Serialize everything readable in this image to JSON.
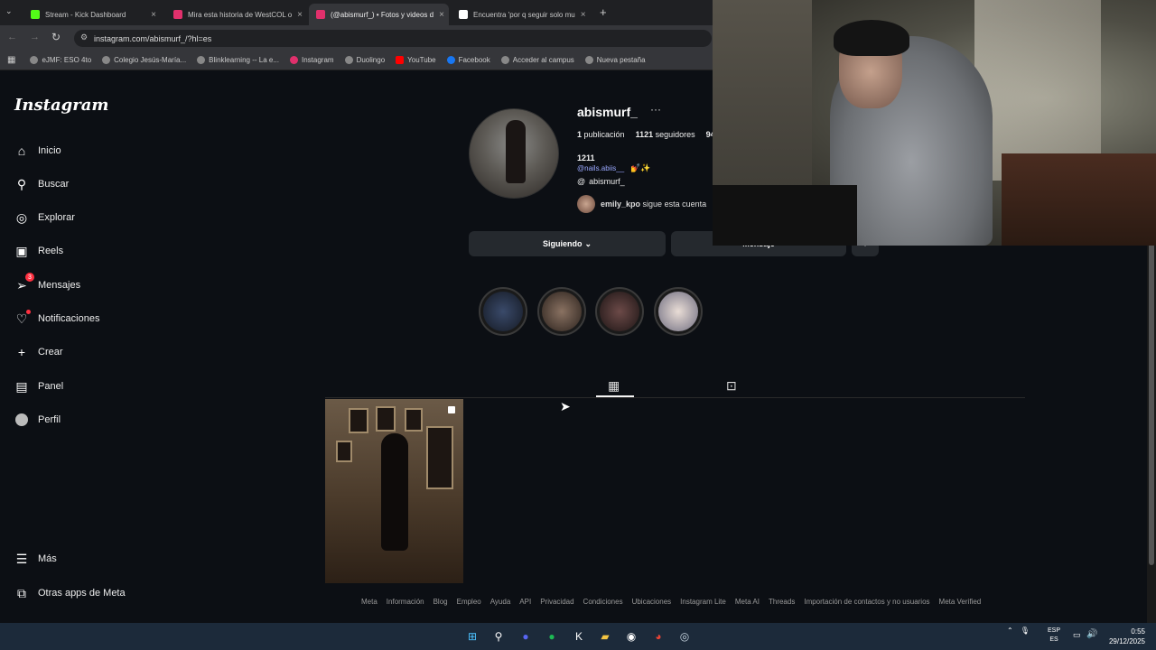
{
  "tabs": [
    {
      "label": "Stream - Kick Dashboard",
      "color": "#53fc18"
    },
    {
      "label": "Mira esta historia de WestCOL o",
      "color": "#e1306c"
    },
    {
      "label": "(@abismurf_) • Fotos y videos d",
      "color": "#e1306c"
    },
    {
      "label": "Encuentra 'por q seguir solo mu",
      "color": "#ffffff"
    }
  ],
  "address": "instagram.com/abismurf_/?hl=es",
  "bookmarks": [
    "eJMF: ESO 4to",
    "Colegio Jesús-María...",
    "Blinklearning -- La e...",
    "Instagram",
    "Duolingo",
    "YouTube",
    "Facebook",
    "Acceder al campus",
    "Nueva pestaña"
  ],
  "sidebar": {
    "logo": "Instagram",
    "items": [
      "Inicio",
      "Buscar",
      "Explorar",
      "Reels",
      "Mensajes",
      "Notificaciones",
      "Crear",
      "Panel",
      "Perfil"
    ],
    "messages_badge": "3",
    "more": "Más",
    "meta_apps": "Otras apps de Meta"
  },
  "profile": {
    "username": "abismurf_",
    "more_glyph": "···",
    "posts_count": "1",
    "posts_label": "publicación",
    "followers_count": "1121",
    "followers_label": "seguidores",
    "following_partial": "943",
    "bio_name": "1211",
    "bio_link": "@nails.abiis__",
    "bio_emoji": "💅✨",
    "threads_handle": "abismurf_",
    "followed_by_user": "emily_kpo",
    "followed_by_text": "sigue esta cuenta",
    "following_button": "Siguiendo",
    "message_button": "Mensaje"
  },
  "footer_links": [
    "Meta",
    "Información",
    "Blog",
    "Empleo",
    "Ayuda",
    "API",
    "Privacidad",
    "Condiciones",
    "Ubicaciones",
    "Instagram Lite",
    "Meta AI",
    "Threads",
    "Importación de contactos y no usuarios",
    "Meta Verified"
  ],
  "taskbar": {
    "lang_top": "ESP",
    "lang_bottom": "ES",
    "time": "0:55",
    "date": "29/12/2025"
  }
}
